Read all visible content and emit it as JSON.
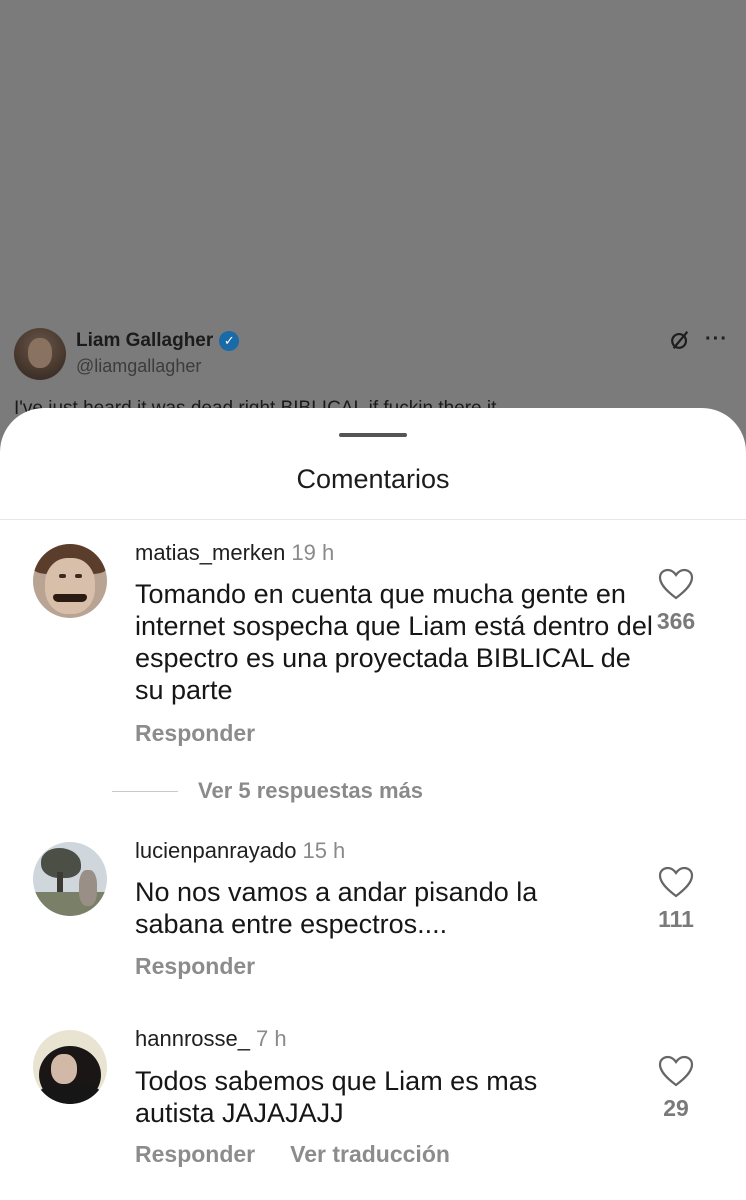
{
  "tweet": {
    "name": "Liam Gallagher",
    "handle": "@liamgallagher",
    "text_partial": "I've just heard it was dead right BIBLICAL if fuckin there it..."
  },
  "sheet": {
    "title": "Comentarios"
  },
  "comments": [
    {
      "username": "matias_merken",
      "time": "19 h",
      "text": "Tomando en cuenta que mucha gente en internet sospecha que Liam está dentro del espectro es una proyectada BIBLICAL de su parte",
      "likes": "366",
      "reply_label": "Responder"
    },
    {
      "username": "lucienpanrayado",
      "time": "15 h",
      "text": "No nos vamos a andar pisando la sabana entre espectros....",
      "likes": "111",
      "reply_label": "Responder"
    },
    {
      "username": "hannrosse_",
      "time": "7 h",
      "text": "Todos sabemos que Liam es mas autista JAJAJAJJ",
      "likes": "29",
      "reply_label": "Responder",
      "translate_label": "Ver traducción"
    }
  ],
  "more_replies": "Ver 5 respuestas más",
  "icons": {
    "verified": "verified-badge-icon",
    "x_logo": "x-logo-icon",
    "more": "more-icon",
    "like": "heart-icon"
  },
  "colors": {
    "overlay": "#7b7b7b",
    "sheet": "#ffffff",
    "verified": "#1a6aa8"
  }
}
